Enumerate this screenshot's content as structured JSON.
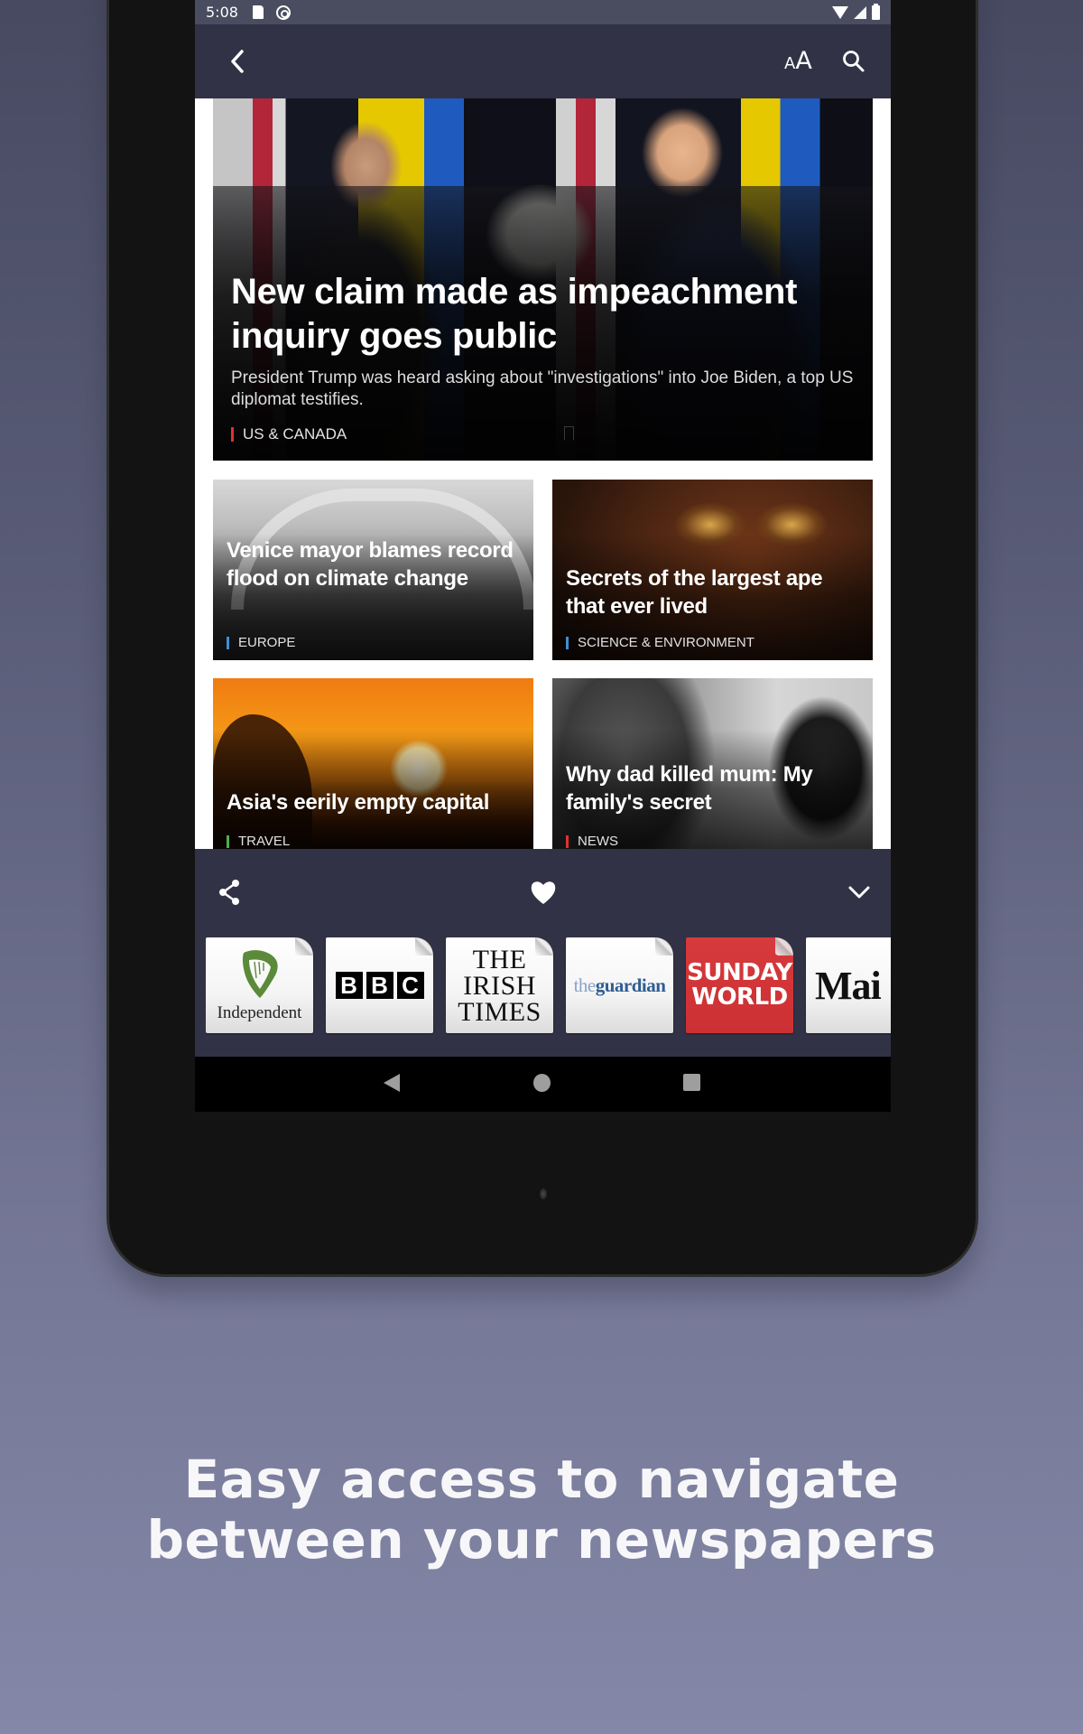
{
  "status_bar": {
    "time": "5:08",
    "left_icons": [
      "sd-card-icon",
      "sync-icon"
    ],
    "right_icons": [
      "wifi-icon",
      "signal-icon",
      "battery-icon"
    ]
  },
  "app_bar": {
    "back_icon": "chevron-left-icon",
    "text_size_label_small": "A",
    "text_size_label_large": "A",
    "search_icon": "search-icon"
  },
  "articles": {
    "hero": {
      "title": "New claim made as impeachment inquiry goes public",
      "summary": "President Trump was heard asking about \"investigations\" into Joe Biden, a top US diplomat testifies.",
      "category": "US & CANADA",
      "category_color": "#e0322f"
    },
    "cards": [
      {
        "title": "Venice mayor blames record flood on climate change",
        "category": "EUROPE",
        "category_color": "#3d8fd6"
      },
      {
        "title": "Secrets of the largest ape that ever lived",
        "category": "SCIENCE & ENVIRONMENT",
        "category_color": "#3d8fd6"
      },
      {
        "title": "Asia's eerily empty capital",
        "category": "TRAVEL",
        "category_color": "#4caf50"
      },
      {
        "title": "Why dad killed mum: My family's secret",
        "category": "NEWS",
        "category_color": "#e0322f"
      }
    ]
  },
  "bottom_bar": {
    "actions": [
      "share-icon",
      "heart-icon",
      "chevron-down-icon"
    ],
    "newspapers": [
      {
        "name": "Independent"
      },
      {
        "name": "BBC",
        "letters": [
          "B",
          "B",
          "C"
        ]
      },
      {
        "name": "The Irish Times",
        "lines": [
          "THE",
          "IRISH",
          "TIMES"
        ]
      },
      {
        "name": "the guardian",
        "prefix": "the",
        "main": "guardian"
      },
      {
        "name": "Sunday World",
        "lines": [
          "SUNDAY",
          "WORLD"
        ]
      },
      {
        "name": "Mail",
        "visible_text": "Mai"
      }
    ]
  },
  "nav_bar": {
    "buttons": [
      "back",
      "home",
      "recents"
    ]
  },
  "caption": {
    "line1": "Easy access to navigate",
    "line2": "between your newspapers"
  }
}
